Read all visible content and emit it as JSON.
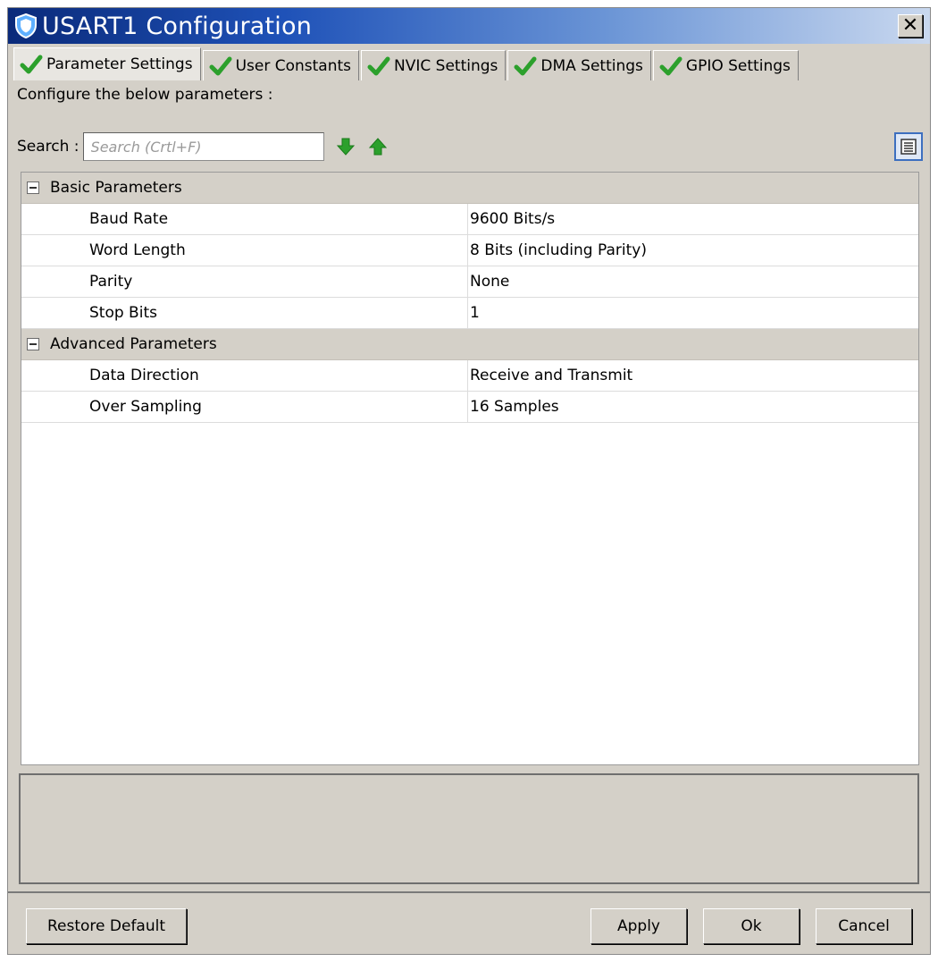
{
  "window": {
    "title": "USART1 Configuration",
    "close_glyph": "✕"
  },
  "tabs": [
    {
      "label": "Parameter Settings",
      "icon": "check-icon"
    },
    {
      "label": "User Constants",
      "icon": "check-icon"
    },
    {
      "label": "NVIC Settings",
      "icon": "check-icon"
    },
    {
      "label": "DMA Settings",
      "icon": "check-icon"
    },
    {
      "label": "GPIO Settings",
      "icon": "check-icon"
    }
  ],
  "pane": {
    "description": "Configure the below parameters :"
  },
  "search": {
    "label": "Search :",
    "placeholder": "Search (Crtl+F)"
  },
  "groups": [
    {
      "title": "Basic Parameters",
      "params": [
        {
          "name": "Baud Rate",
          "value": "9600 Bits/s"
        },
        {
          "name": "Word Length",
          "value": "8 Bits (including Parity)"
        },
        {
          "name": "Parity",
          "value": "None"
        },
        {
          "name": "Stop Bits",
          "value": "1"
        }
      ]
    },
    {
      "title": "Advanced Parameters",
      "params": [
        {
          "name": "Data Direction",
          "value": "Receive and Transmit"
        },
        {
          "name": "Over Sampling",
          "value": "16 Samples"
        }
      ]
    }
  ],
  "buttons": {
    "restore": "Restore Default",
    "apply": "Apply",
    "ok": "Ok",
    "cancel": "Cancel"
  },
  "colors": {
    "accent_green": "#2ca02c",
    "titlebar_blue": "#1f52b8",
    "group_bg": "#d4d0c8"
  }
}
